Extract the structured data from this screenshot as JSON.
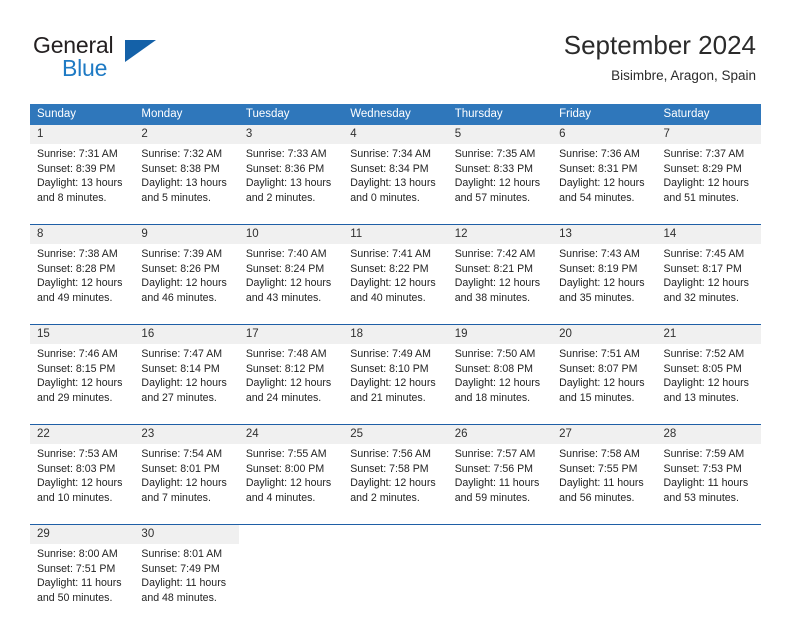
{
  "brand": {
    "word_one": "General",
    "word_two": "Blue",
    "logo_icon": "triangle-logo-icon"
  },
  "header": {
    "title": "September 2024",
    "location": "Bisimbre, Aragon, Spain"
  },
  "calendar": {
    "weekday_headers": [
      "Sunday",
      "Monday",
      "Tuesday",
      "Wednesday",
      "Thursday",
      "Friday",
      "Saturday"
    ],
    "colors": {
      "header_blue": "#2f77bb",
      "separator_blue": "#1f5fa6",
      "daynum_background": "#f0f0f0",
      "brand_blue": "#1e7ac4"
    },
    "weeks": [
      [
        {
          "day": "1",
          "sunrise": "Sunrise: 7:31 AM",
          "sunset": "Sunset: 8:39 PM",
          "daylight_line1": "Daylight: 13 hours",
          "daylight_line2": "and 8 minutes."
        },
        {
          "day": "2",
          "sunrise": "Sunrise: 7:32 AM",
          "sunset": "Sunset: 8:38 PM",
          "daylight_line1": "Daylight: 13 hours",
          "daylight_line2": "and 5 minutes."
        },
        {
          "day": "3",
          "sunrise": "Sunrise: 7:33 AM",
          "sunset": "Sunset: 8:36 PM",
          "daylight_line1": "Daylight: 13 hours",
          "daylight_line2": "and 2 minutes."
        },
        {
          "day": "4",
          "sunrise": "Sunrise: 7:34 AM",
          "sunset": "Sunset: 8:34 PM",
          "daylight_line1": "Daylight: 13 hours",
          "daylight_line2": "and 0 minutes."
        },
        {
          "day": "5",
          "sunrise": "Sunrise: 7:35 AM",
          "sunset": "Sunset: 8:33 PM",
          "daylight_line1": "Daylight: 12 hours",
          "daylight_line2": "and 57 minutes."
        },
        {
          "day": "6",
          "sunrise": "Sunrise: 7:36 AM",
          "sunset": "Sunset: 8:31 PM",
          "daylight_line1": "Daylight: 12 hours",
          "daylight_line2": "and 54 minutes."
        },
        {
          "day": "7",
          "sunrise": "Sunrise: 7:37 AM",
          "sunset": "Sunset: 8:29 PM",
          "daylight_line1": "Daylight: 12 hours",
          "daylight_line2": "and 51 minutes."
        }
      ],
      [
        {
          "day": "8",
          "sunrise": "Sunrise: 7:38 AM",
          "sunset": "Sunset: 8:28 PM",
          "daylight_line1": "Daylight: 12 hours",
          "daylight_line2": "and 49 minutes."
        },
        {
          "day": "9",
          "sunrise": "Sunrise: 7:39 AM",
          "sunset": "Sunset: 8:26 PM",
          "daylight_line1": "Daylight: 12 hours",
          "daylight_line2": "and 46 minutes."
        },
        {
          "day": "10",
          "sunrise": "Sunrise: 7:40 AM",
          "sunset": "Sunset: 8:24 PM",
          "daylight_line1": "Daylight: 12 hours",
          "daylight_line2": "and 43 minutes."
        },
        {
          "day": "11",
          "sunrise": "Sunrise: 7:41 AM",
          "sunset": "Sunset: 8:22 PM",
          "daylight_line1": "Daylight: 12 hours",
          "daylight_line2": "and 40 minutes."
        },
        {
          "day": "12",
          "sunrise": "Sunrise: 7:42 AM",
          "sunset": "Sunset: 8:21 PM",
          "daylight_line1": "Daylight: 12 hours",
          "daylight_line2": "and 38 minutes."
        },
        {
          "day": "13",
          "sunrise": "Sunrise: 7:43 AM",
          "sunset": "Sunset: 8:19 PM",
          "daylight_line1": "Daylight: 12 hours",
          "daylight_line2": "and 35 minutes."
        },
        {
          "day": "14",
          "sunrise": "Sunrise: 7:45 AM",
          "sunset": "Sunset: 8:17 PM",
          "daylight_line1": "Daylight: 12 hours",
          "daylight_line2": "and 32 minutes."
        }
      ],
      [
        {
          "day": "15",
          "sunrise": "Sunrise: 7:46 AM",
          "sunset": "Sunset: 8:15 PM",
          "daylight_line1": "Daylight: 12 hours",
          "daylight_line2": "and 29 minutes."
        },
        {
          "day": "16",
          "sunrise": "Sunrise: 7:47 AM",
          "sunset": "Sunset: 8:14 PM",
          "daylight_line1": "Daylight: 12 hours",
          "daylight_line2": "and 27 minutes."
        },
        {
          "day": "17",
          "sunrise": "Sunrise: 7:48 AM",
          "sunset": "Sunset: 8:12 PM",
          "daylight_line1": "Daylight: 12 hours",
          "daylight_line2": "and 24 minutes."
        },
        {
          "day": "18",
          "sunrise": "Sunrise: 7:49 AM",
          "sunset": "Sunset: 8:10 PM",
          "daylight_line1": "Daylight: 12 hours",
          "daylight_line2": "and 21 minutes."
        },
        {
          "day": "19",
          "sunrise": "Sunrise: 7:50 AM",
          "sunset": "Sunset: 8:08 PM",
          "daylight_line1": "Daylight: 12 hours",
          "daylight_line2": "and 18 minutes."
        },
        {
          "day": "20",
          "sunrise": "Sunrise: 7:51 AM",
          "sunset": "Sunset: 8:07 PM",
          "daylight_line1": "Daylight: 12 hours",
          "daylight_line2": "and 15 minutes."
        },
        {
          "day": "21",
          "sunrise": "Sunrise: 7:52 AM",
          "sunset": "Sunset: 8:05 PM",
          "daylight_line1": "Daylight: 12 hours",
          "daylight_line2": "and 13 minutes."
        }
      ],
      [
        {
          "day": "22",
          "sunrise": "Sunrise: 7:53 AM",
          "sunset": "Sunset: 8:03 PM",
          "daylight_line1": "Daylight: 12 hours",
          "daylight_line2": "and 10 minutes."
        },
        {
          "day": "23",
          "sunrise": "Sunrise: 7:54 AM",
          "sunset": "Sunset: 8:01 PM",
          "daylight_line1": "Daylight: 12 hours",
          "daylight_line2": "and 7 minutes."
        },
        {
          "day": "24",
          "sunrise": "Sunrise: 7:55 AM",
          "sunset": "Sunset: 8:00 PM",
          "daylight_line1": "Daylight: 12 hours",
          "daylight_line2": "and 4 minutes."
        },
        {
          "day": "25",
          "sunrise": "Sunrise: 7:56 AM",
          "sunset": "Sunset: 7:58 PM",
          "daylight_line1": "Daylight: 12 hours",
          "daylight_line2": "and 2 minutes."
        },
        {
          "day": "26",
          "sunrise": "Sunrise: 7:57 AM",
          "sunset": "Sunset: 7:56 PM",
          "daylight_line1": "Daylight: 11 hours",
          "daylight_line2": "and 59 minutes."
        },
        {
          "day": "27",
          "sunrise": "Sunrise: 7:58 AM",
          "sunset": "Sunset: 7:55 PM",
          "daylight_line1": "Daylight: 11 hours",
          "daylight_line2": "and 56 minutes."
        },
        {
          "day": "28",
          "sunrise": "Sunrise: 7:59 AM",
          "sunset": "Sunset: 7:53 PM",
          "daylight_line1": "Daylight: 11 hours",
          "daylight_line2": "and 53 minutes."
        }
      ],
      [
        {
          "day": "29",
          "sunrise": "Sunrise: 8:00 AM",
          "sunset": "Sunset: 7:51 PM",
          "daylight_line1": "Daylight: 11 hours",
          "daylight_line2": "and 50 minutes."
        },
        {
          "day": "30",
          "sunrise": "Sunrise: 8:01 AM",
          "sunset": "Sunset: 7:49 PM",
          "daylight_line1": "Daylight: 11 hours",
          "daylight_line2": "and 48 minutes."
        },
        {
          "day": "",
          "sunrise": "",
          "sunset": "",
          "daylight_line1": "",
          "daylight_line2": ""
        },
        {
          "day": "",
          "sunrise": "",
          "sunset": "",
          "daylight_line1": "",
          "daylight_line2": ""
        },
        {
          "day": "",
          "sunrise": "",
          "sunset": "",
          "daylight_line1": "",
          "daylight_line2": ""
        },
        {
          "day": "",
          "sunrise": "",
          "sunset": "",
          "daylight_line1": "",
          "daylight_line2": ""
        },
        {
          "day": "",
          "sunrise": "",
          "sunset": "",
          "daylight_line1": "",
          "daylight_line2": ""
        }
      ]
    ]
  }
}
